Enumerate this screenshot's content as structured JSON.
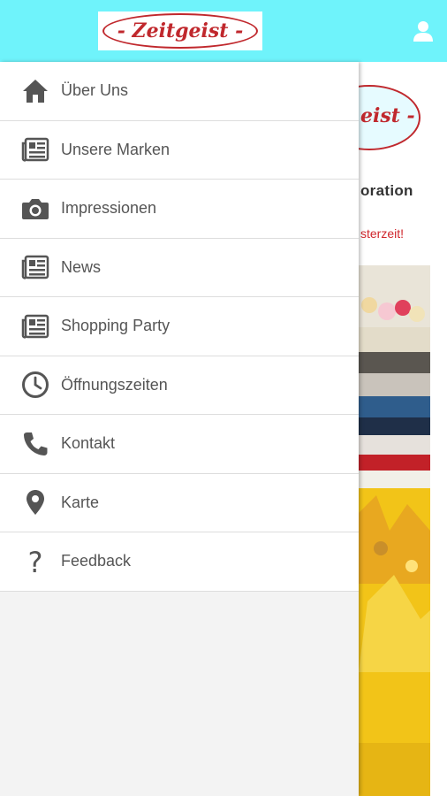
{
  "header": {
    "logo_text": "- Zeitgeist -",
    "brand_color": "#6ff3fb",
    "user_icon": "user-icon"
  },
  "background_page": {
    "logo_fragment": "eist -",
    "heading_fragment": "oration",
    "red_text_fragment": "sterzeit!"
  },
  "drawer": {
    "items": [
      {
        "label": "Über Uns",
        "icon": "home-icon"
      },
      {
        "label": "Unsere Marken",
        "icon": "newspaper-icon"
      },
      {
        "label": "Impressionen",
        "icon": "camera-icon"
      },
      {
        "label": "News",
        "icon": "newspaper-icon"
      },
      {
        "label": "Shopping Party",
        "icon": "newspaper-icon"
      },
      {
        "label": "Öffnungszeiten",
        "icon": "clock-icon"
      },
      {
        "label": "Kontakt",
        "icon": "phone-icon"
      },
      {
        "label": "Karte",
        "icon": "map-pin-icon"
      },
      {
        "label": "Feedback",
        "icon": "question-icon"
      }
    ]
  }
}
